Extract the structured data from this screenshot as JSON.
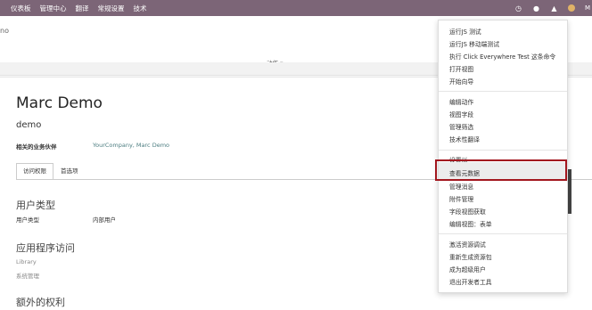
{
  "topbar": {
    "menu": [
      "仪表板",
      "管理中心",
      "翻译",
      "常规设置",
      "技术"
    ],
    "user_initial": "M"
  },
  "control": {
    "breadcrumb": "no",
    "action_label": "动作 ▾"
  },
  "form": {
    "name": "Marc Demo",
    "login": "demo",
    "partner_label": "相关的业务伙伴",
    "partner_value": "YourCompany, Marc Demo",
    "tabs": [
      "访问权限",
      "首选项"
    ],
    "section_user_type": "用户类型",
    "user_type_label": "用户类型",
    "user_type_value": "内部用户",
    "section_app_access": "应用程序访问",
    "app_items": [
      "Library",
      "系统管理"
    ],
    "section_extra": "额外的权利"
  },
  "debug_menu": {
    "groups": [
      [
        "运行JS 测试",
        "运行JS 移动端测试",
        "执行 Click Everywhere Test 这条命令",
        "打开视图",
        "开始向导"
      ],
      [
        "编辑动作",
        "视图字段",
        "管理筛选",
        "技术性翻译"
      ],
      [
        "设置以",
        "查看元数据",
        "管理消息",
        "附件管理",
        "字段视图获取",
        "编辑视图：表单"
      ],
      [
        "激活资源调试",
        "重新生成资源包",
        "成为超级用户",
        "退出开发者工具"
      ]
    ],
    "highlighted": "查看元数据"
  },
  "colors": {
    "topbar": "#7c6577",
    "link": "#4c7d80",
    "highlight_border": "#a3171f"
  }
}
